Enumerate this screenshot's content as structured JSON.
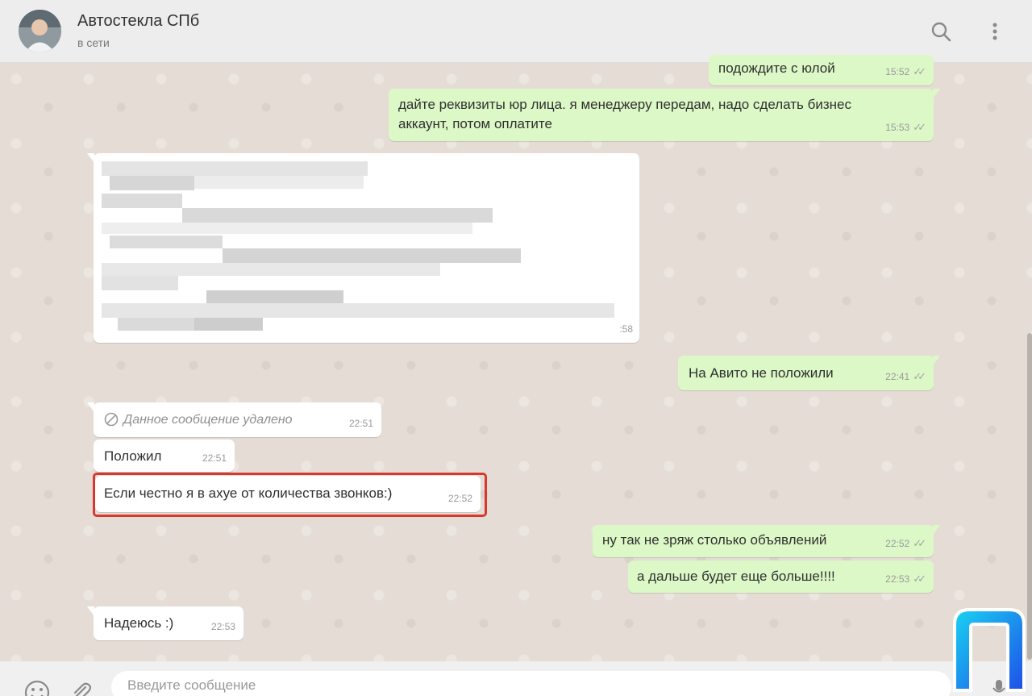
{
  "header": {
    "contact_name": "Автостекла СПб",
    "contact_status": "в сети",
    "search_icon": "search-icon",
    "menu_icon": "kebab-menu-icon"
  },
  "messages": [
    {
      "dir": "out",
      "text": "подождите с юлой",
      "time": "15:52",
      "status": "read"
    },
    {
      "dir": "out",
      "text": "дайте реквизиты юр лица. я менеджеру передам, надо сделать бизнес аккаунт, потом оплатите",
      "time": "15:53",
      "status": "read"
    },
    {
      "dir": "in",
      "text": "",
      "time": ":58",
      "status": "blurred"
    },
    {
      "dir": "out",
      "text": "На Авито не положили",
      "time": "22:41",
      "status": "read"
    },
    {
      "dir": "in",
      "text": "Данное сообщение удалено",
      "time": "22:51",
      "status": "deleted"
    },
    {
      "dir": "in",
      "text": "Положил",
      "time": "22:51"
    },
    {
      "dir": "in",
      "text": "Если честно я в ахуе от количества звонков:)",
      "time": "22:52",
      "highlighted": true
    },
    {
      "dir": "out",
      "text": "ну так не зряж столько объявлений",
      "time": "22:52",
      "status": "read"
    },
    {
      "dir": "out",
      "text": "а дальше будет еще больше!!!!",
      "time": "22:53",
      "status": "read"
    },
    {
      "dir": "in",
      "text": "Надеюсь :)",
      "time": "22:53"
    }
  ],
  "footer": {
    "input_placeholder": "Введите сообщение",
    "emoji_icon": "emoji-icon",
    "attach_icon": "paperclip-icon",
    "mic_icon": "microphone-icon"
  },
  "colors": {
    "outgoing_bubble": "#dcf8c6",
    "incoming_bubble": "#ffffff",
    "chat_background": "#e5ddd5",
    "highlight_border": "#d9382e",
    "watermark_logo": "#1e6cf0"
  }
}
